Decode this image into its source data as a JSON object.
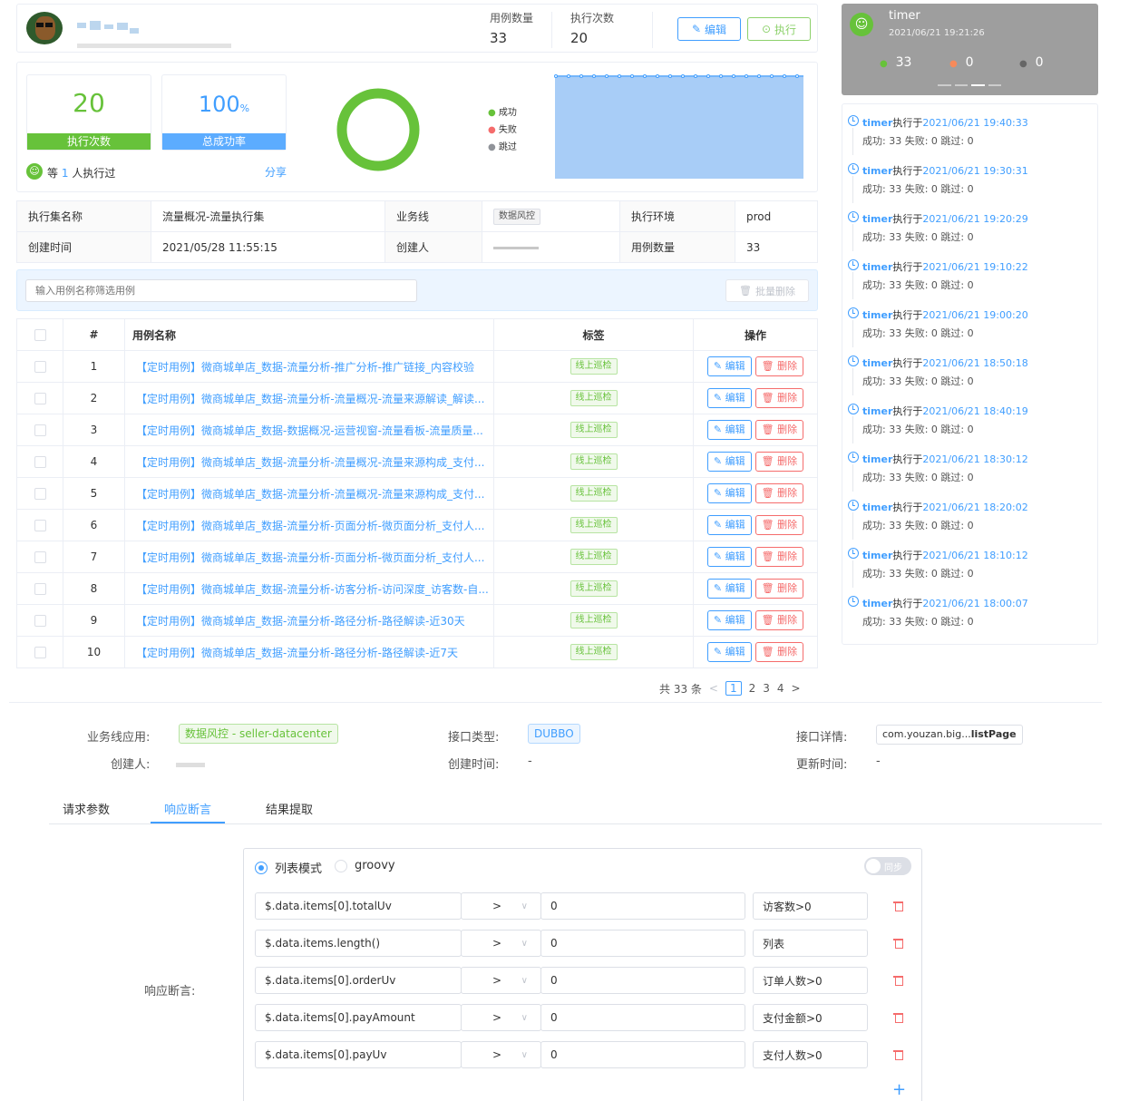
{
  "header": {
    "case_count_label": "用例数量",
    "case_count": "33",
    "exec_count_label": "执行次数",
    "exec_count": "20",
    "edit_label": "编辑",
    "run_label": "执行"
  },
  "stats": {
    "exec_times": "20",
    "exec_times_label": "执行次数",
    "success_rate": "100",
    "success_rate_unit": "%",
    "success_rate_label": "总成功率",
    "executor_prefix": "等",
    "executor_count": "1",
    "executor_suffix": "人执行过",
    "share_label": "分享",
    "legend": [
      {
        "label": "成功",
        "color": "#67c23a"
      },
      {
        "label": "失败",
        "color": "#f56c6c"
      },
      {
        "label": "跳过",
        "color": "#909399"
      }
    ]
  },
  "meta": {
    "set_name_label": "执行集名称",
    "set_name": "流量概况-流量执行集",
    "biz_label": "业务线",
    "biz": "数据风控",
    "env_label": "执行环境",
    "env": "prod",
    "created_label": "创建时间",
    "created": "2021/05/28 11:55:15",
    "creator_label": "创建人",
    "count_label": "用例数量",
    "count": "33"
  },
  "filter": {
    "placeholder": "输入用例名称筛选用例",
    "batch_delete": "批量删除"
  },
  "table": {
    "headers": [
      "#",
      "用例名称",
      "标签",
      "操作"
    ],
    "tag": "线上巡检",
    "edit": "编辑",
    "delete": "删除",
    "rows": [
      {
        "no": "1",
        "name": "【定时用例】微商城单店_数据-流量分析-推广分析-推广链接_内容校验"
      },
      {
        "no": "2",
        "name": "【定时用例】微商城单店_数据-流量分析-流量概况-流量来源解读_解读..."
      },
      {
        "no": "3",
        "name": "【定时用例】微商城单店_数据-数据概况-运营视窗-流量看板-流量质量..."
      },
      {
        "no": "4",
        "name": "【定时用例】微商城单店_数据-流量分析-流量概况-流量来源构成_支付..."
      },
      {
        "no": "5",
        "name": "【定时用例】微商城单店_数据-流量分析-流量概况-流量来源构成_支付..."
      },
      {
        "no": "6",
        "name": "【定时用例】微商城单店_数据-流量分析-页面分析-微页面分析_支付人..."
      },
      {
        "no": "7",
        "name": "【定时用例】微商城单店_数据-流量分析-页面分析-微页面分析_支付人..."
      },
      {
        "no": "8",
        "name": "【定时用例】微商城单店_数据-流量分析-访客分析-访问深度_访客数-自..."
      },
      {
        "no": "9",
        "name": "【定时用例】微商城单店_数据-流量分析-路径分析-路径解读-近30天"
      },
      {
        "no": "10",
        "name": "【定时用例】微商城单店_数据-流量分析-路径分析-路径解读-近7天"
      }
    ]
  },
  "pagination": {
    "total": "共 33 条",
    "pages": [
      "1",
      "2",
      "3",
      "4"
    ],
    "prev": "<",
    "next": ">"
  },
  "timer": {
    "name": "timer",
    "time": "2021/06/21 19:21:26",
    "success": "33",
    "fail": "0",
    "skip": "0"
  },
  "timeline": [
    {
      "user": "timer",
      "verb": "执行于",
      "time": "2021/06/21 19:40:33",
      "result": "成功: 33 失败: 0 跳过: 0"
    },
    {
      "user": "timer",
      "verb": "执行于",
      "time": "2021/06/21 19:30:31",
      "result": "成功: 33 失败: 0 跳过: 0"
    },
    {
      "user": "timer",
      "verb": "执行于",
      "time": "2021/06/21 19:20:29",
      "result": "成功: 33 失败: 0 跳过: 0"
    },
    {
      "user": "timer",
      "verb": "执行于",
      "time": "2021/06/21 19:10:22",
      "result": "成功: 33 失败: 0 跳过: 0"
    },
    {
      "user": "timer",
      "verb": "执行于",
      "time": "2021/06/21 19:00:20",
      "result": "成功: 33 失败: 0 跳过: 0"
    },
    {
      "user": "timer",
      "verb": "执行于",
      "time": "2021/06/21 18:50:18",
      "result": "成功: 33 失败: 0 跳过: 0"
    },
    {
      "user": "timer",
      "verb": "执行于",
      "time": "2021/06/21 18:40:19",
      "result": "成功: 33 失败: 0 跳过: 0"
    },
    {
      "user": "timer",
      "verb": "执行于",
      "time": "2021/06/21 18:30:12",
      "result": "成功: 33 失败: 0 跳过: 0"
    },
    {
      "user": "timer",
      "verb": "执行于",
      "time": "2021/06/21 18:20:02",
      "result": "成功: 33 失败: 0 跳过: 0"
    },
    {
      "user": "timer",
      "verb": "执行于",
      "time": "2021/06/21 18:10:12",
      "result": "成功: 33 失败: 0 跳过: 0"
    },
    {
      "user": "timer",
      "verb": "执行于",
      "time": "2021/06/21 18:00:07",
      "result": "成功: 33 失败: 0 跳过: 0"
    }
  ],
  "api": {
    "biz_app_label": "业务线应用:",
    "biz_app": "数据风控 - seller-datacenter",
    "type_label": "接口类型:",
    "type": "DUBBO",
    "detail_label": "接口详情:",
    "detail_prefix": "com.youzan.big...",
    "detail_method": "listPage",
    "creator_label": "创建人:",
    "created_label": "创建时间:",
    "created": "-",
    "updated_label": "更新时间:",
    "updated": "-"
  },
  "tabs": [
    "请求参数",
    "响应断言",
    "结果提取"
  ],
  "assert": {
    "label": "响应断言:",
    "mode_list": "列表模式",
    "mode_groovy": "groovy",
    "sync": "同步",
    "add": "+",
    "rows": [
      {
        "path": "$.data.items[0].totalUv",
        "op": ">",
        "value": "0",
        "desc": "访客数>0"
      },
      {
        "path": "$.data.items.length()",
        "op": ">",
        "value": "0",
        "desc": "列表"
      },
      {
        "path": "$.data.items[0].orderUv",
        "op": ">",
        "value": "0",
        "desc": "订单人数>0"
      },
      {
        "path": "$.data.items[0].payAmount",
        "op": ">",
        "value": "0",
        "desc": "支付金额>0"
      },
      {
        "path": "$.data.items[0].payUv",
        "op": ">",
        "value": "0",
        "desc": "支付人数>0"
      }
    ]
  }
}
